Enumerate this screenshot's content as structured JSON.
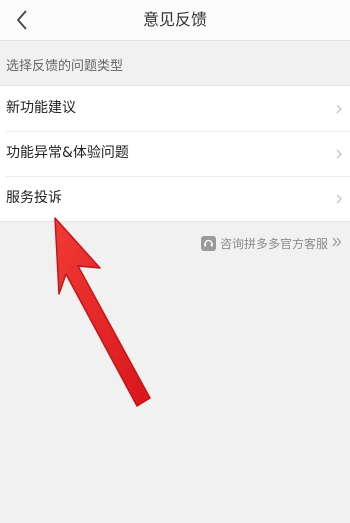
{
  "header": {
    "title": "意见反馈",
    "back_icon": "chevron-left-icon"
  },
  "section": {
    "label": "选择反馈的问题类型"
  },
  "feedback_types": [
    {
      "label": "新功能建议"
    },
    {
      "label": "功能异常&体验问题"
    },
    {
      "label": "服务投诉"
    }
  ],
  "service_link": {
    "label": "咨询拼多多官方客服",
    "icon": "customer-service-icon",
    "trailing_icon": "double-chevron-right-icon"
  },
  "annotation": {
    "icon": "red-pointer-arrow-icon",
    "color": "#e8221f"
  }
}
